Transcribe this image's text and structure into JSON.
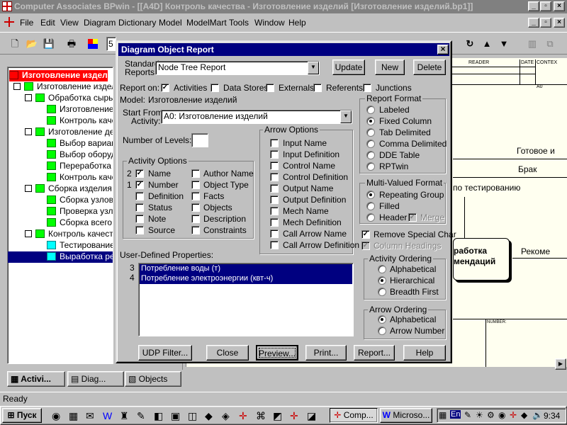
{
  "window": {
    "title": "Computer Associates BPwin - [[A4D] Контроль качества - Изготовление изделий  [Изготовление изделий.bp1]]"
  },
  "menu": [
    "File",
    "Edit",
    "View",
    "Diagram",
    "Dictionary",
    "Model",
    "ModelMart",
    "Tools",
    "Window",
    "Help"
  ],
  "toolbar": {
    "zoom_value": "5"
  },
  "tree": {
    "root": "Изготовление издел",
    "items": [
      "Изготовление издел",
      "Обработка сырья",
      "Изготовление",
      "Контроль каче",
      "Изготовление де",
      "Выбор вариан",
      "Выбор оборуд",
      "Переработка г",
      "Контроль каче",
      "Сборка изделия",
      "Сборка узлов",
      "Проверка узло",
      "Сборка всего и",
      "Контроль качест",
      "Тестирование",
      "Выработка рек"
    ]
  },
  "tabs": [
    "Activi...",
    "Diag...",
    "Objects"
  ],
  "status": "Ready",
  "taskbar": {
    "start": "Пуск",
    "tasks": [
      "Comp...",
      "Microso..."
    ],
    "tray_lang": "En",
    "clock": "9:34"
  },
  "canvas": {
    "header_reader": "READER",
    "header_date": "DATE",
    "header_context": "CONTEX",
    "node_a0": "A0",
    "text_ready": "Готовое и",
    "text_defect": "Брак",
    "text_testing": "по тестированию",
    "box_line1": "работка",
    "box_line2": "мендаций",
    "text_recommend": "Рекоме",
    "footer_number": "NUMBER:"
  },
  "dialog": {
    "title": "Diagram Object Report",
    "standard_reports_label_1": "Standard",
    "standard_reports_label_2": "Reports:",
    "standard_reports_value": "Node Tree Report",
    "update": "Update",
    "new": "New",
    "delete": "Delete",
    "report_on": "Report on:",
    "report_on_items": [
      "Activities",
      "Data Stores",
      "Externals",
      "Referents",
      "Junctions"
    ],
    "model_label": "Model:",
    "model_value": "Изготовление изделий",
    "start_from_1": "Start From",
    "start_from_2": "Activity:",
    "start_from_value": "A0:  Изготовление изделий",
    "number_of_levels": "Number of Levels:",
    "activity_options_title": "Activity Options",
    "activity_left": [
      "Name",
      "Number",
      "Definition",
      "Status",
      "Note",
      "Source"
    ],
    "activity_left_order": [
      "2",
      "1",
      "",
      "",
      "",
      ""
    ],
    "activity_right": [
      "Author Name",
      "Object Type",
      "Facts",
      "Objects",
      "Description",
      "Constraints"
    ],
    "arrow_options_title": "Arrow Options",
    "arrow_options": [
      "Input Name",
      "Input Definition",
      "Control Name",
      "Control Definition",
      "Output Name",
      "Output Definition",
      "Mech Name",
      "Mech Definition",
      "Call Arrow Name",
      "Call Arrow Definition"
    ],
    "user_defined_label": "User-Defined Properties:",
    "user_defined_items": [
      "Потребление воды (т)",
      "Потребление электроэнергии (квт-ч)"
    ],
    "user_defined_order": [
      "3",
      "4"
    ],
    "report_format_title": "Report Format",
    "report_format": [
      "Labeled",
      "Fixed Column",
      "Tab Delimited",
      "Comma Delimited",
      "DDE Table",
      "RPTwin"
    ],
    "multi_valued_title": "Multi-Valued Format",
    "multi_valued": [
      "Repeating Group",
      "Filled",
      "Header"
    ],
    "merge": "Merge",
    "remove_special": "Remove Special Char",
    "column_headings": "Column Headings",
    "activity_ordering_title": "Activity Ordering",
    "activity_ordering": [
      "Alphabetical",
      "Hierarchical",
      "Breadth First"
    ],
    "arrow_ordering_title": "Arrow Ordering",
    "arrow_ordering": [
      "Alphabetical",
      "Arrow Number"
    ],
    "buttons": [
      "UDP Filter...",
      "Close",
      "Preview...",
      "Print...",
      "Report...",
      "Help"
    ],
    "close_x": "×"
  }
}
